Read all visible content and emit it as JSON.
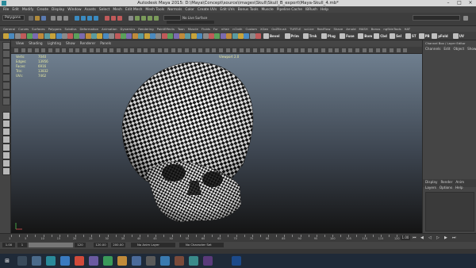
{
  "window": {
    "title": "Autodesk Maya 2015: D:\\Maya\\Concept\\source\\images\\Skull\\Skull_B_export\\Maya-Skull_4.mb*"
  },
  "menus": [
    "File",
    "Edit",
    "Modify",
    "Create",
    "Display",
    "Window",
    "Assets",
    "Select",
    "Mesh",
    "Edit Mesh",
    "Mesh Tools",
    "Normals",
    "Color",
    "Create UVs",
    "Edit UVs",
    "Bonus Tools",
    "Muscle",
    "Pipeline Cache",
    "IBRush",
    "Help"
  ],
  "status": {
    "mode": "Polygons",
    "live_surface": "No Live Surface"
  },
  "shelf_tabs": [
    "General",
    "Curves",
    "Surfaces",
    "Polygons",
    "Subdivs",
    "Deformation",
    "Animation",
    "Dynamics",
    "Rendering",
    "PaintEffects",
    "Toon",
    "Muscle",
    "Fluids",
    "Fur",
    "nHair",
    "nCloth",
    "Custom",
    "XGen",
    "GoZBrush",
    "TURTLE",
    "sol-ice",
    "RealFlow",
    "Shave",
    "Arnold",
    "MASH",
    "Bonus",
    "ngSkinTools",
    "HAT"
  ],
  "shelf_labels": [
    "Bevel",
    "Prim",
    "Trnk",
    "Plug",
    "Fuse",
    "Bom",
    "Cbd",
    "Sel",
    "ST",
    "PB",
    "pFold",
    "UV"
  ],
  "panel_menu": [
    "View",
    "Shading",
    "Lighting",
    "Show",
    "Renderer",
    "Panels"
  ],
  "hud": {
    "rows": [
      "Verts:",
      "Edges:",
      "Faces:",
      "Tris:",
      "UVs:"
    ],
    "values": [
      "7040",
      "13956",
      "6916",
      "13832",
      "7462"
    ],
    "camera_label": "Viewport 2.0"
  },
  "right_panel": {
    "header": "Channel Box / Layer Editor",
    "tabs": [
      "Channels",
      "Edit",
      "Object",
      "Show"
    ],
    "layer_tabs": [
      "Display",
      "Render",
      "Anim"
    ],
    "layer_menu": [
      "Layers",
      "Options",
      "Help"
    ]
  },
  "timeline": {
    "ticks": [
      "1",
      "",
      "5",
      "",
      "10",
      "",
      "15",
      "",
      "20",
      "",
      "25",
      "",
      "30",
      "",
      "35",
      "",
      "40",
      "",
      "45",
      "",
      "50",
      "",
      "55",
      "",
      "60",
      "",
      "65",
      "",
      "70",
      "",
      "75",
      "",
      "80",
      "",
      "85",
      "",
      "90",
      "",
      "95",
      "",
      "100",
      "",
      "105",
      "",
      "110",
      "",
      "115",
      "",
      "120"
    ],
    "current_frame": "1.00",
    "range_start": "1.00",
    "range_inner_start": "1",
    "range_inner_end": "120",
    "range_end_a": "120.00",
    "range_end_b": "200.00",
    "anim_layer": "No Anim Layer",
    "char_set": "No Character Set"
  },
  "colors": {
    "accent": "#2a8a9a",
    "viewport_top": "#6f7f8f",
    "viewport_bottom": "#141414",
    "taskbar": "#1f2a38"
  }
}
